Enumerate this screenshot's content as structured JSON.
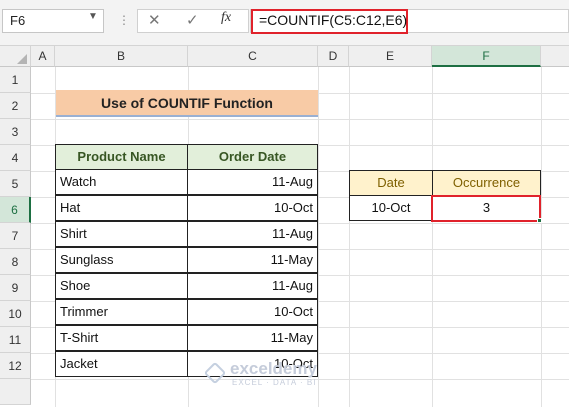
{
  "formula_bar": {
    "name_box": "F6",
    "cancel_symbol": "✕",
    "enter_symbol": "✓",
    "fx_label": "fx",
    "formula": "=COUNTIF(C5:C12,E6)"
  },
  "columns": [
    "A",
    "B",
    "C",
    "D",
    "E",
    "F"
  ],
  "rows": [
    "1",
    "2",
    "3",
    "4",
    "5",
    "6",
    "7",
    "8",
    "9",
    "10",
    "11",
    "12"
  ],
  "title": "Use of COUNTIF Function",
  "table": {
    "headers": [
      "Product Name",
      "Order Date"
    ],
    "rows": [
      {
        "product": "Watch",
        "date": "11-Aug"
      },
      {
        "product": "Hat",
        "date": "10-Oct"
      },
      {
        "product": "Shirt",
        "date": "11-Aug"
      },
      {
        "product": "Sunglass",
        "date": "11-May"
      },
      {
        "product": "Shoe",
        "date": "11-Aug"
      },
      {
        "product": "Trimmer",
        "date": "10-Oct"
      },
      {
        "product": "T-Shirt",
        "date": "11-May"
      },
      {
        "product": "Jacket",
        "date": "10-Oct"
      }
    ]
  },
  "lookup": {
    "headers": [
      "Date",
      "Occurrence"
    ],
    "date": "10-Oct",
    "occurrence": "3"
  },
  "watermark": {
    "title": "exceldemy",
    "subtitle": "EXCEL · DATA · BI"
  },
  "colors": {
    "excel_green": "#1d6f42",
    "highlight_red": "#e0222b",
    "title_fill": "#f8cba6",
    "header_green": "#e2efda",
    "header_yellow": "#fff2cc"
  }
}
